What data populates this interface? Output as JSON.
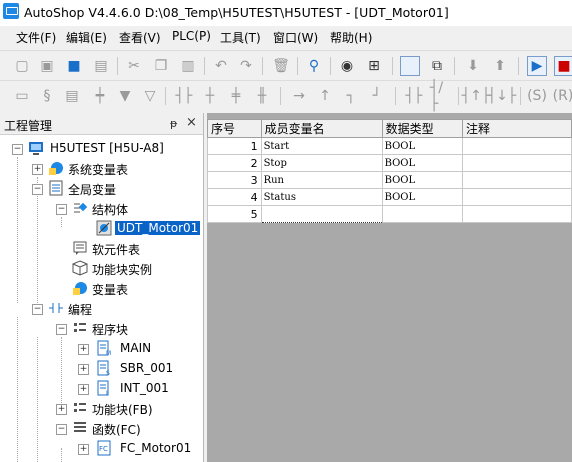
{
  "window": {
    "title": "AutoShop V4.4.6.0  D:\\08_Temp\\H5UTEST\\H5UTEST - [UDT_Motor01]"
  },
  "menu": [
    "文件(F)",
    "编辑(E)",
    "查看(V)",
    "PLC(P)",
    "工具(T)",
    "窗口(W)",
    "帮助(H)"
  ],
  "panel": {
    "title": "工程管理",
    "pin": "ᵽ",
    "close": "×"
  },
  "tree": {
    "root": "H5UTEST [H5U-A8]",
    "system_vars": "系统变量表",
    "global_vars": "全局变量",
    "struct": "结构体",
    "udt": "UDT_Motor01",
    "device_table": "软元件表",
    "fb_instance": "功能块实例",
    "var_table": "变量表",
    "program": "编程",
    "program_block": "程序块",
    "main": "MAIN",
    "sbr": "SBR_001",
    "int": "INT_001",
    "fb": "功能块(FB)",
    "fc": "函数(FC)",
    "fc_motor": "FC_Motor01"
  },
  "grid": {
    "headers": [
      "序号",
      "成员变量名",
      "数据类型",
      "注释"
    ],
    "rows": [
      {
        "no": "1",
        "name": "Start",
        "type": "BOOL",
        "comment": ""
      },
      {
        "no": "2",
        "name": "Stop",
        "type": "BOOL",
        "comment": ""
      },
      {
        "no": "3",
        "name": "Run",
        "type": "BOOL",
        "comment": ""
      },
      {
        "no": "4",
        "name": "Status",
        "type": "BOOL",
        "comment": ""
      },
      {
        "no": "5",
        "name": "",
        "type": "",
        "comment": ""
      }
    ]
  }
}
